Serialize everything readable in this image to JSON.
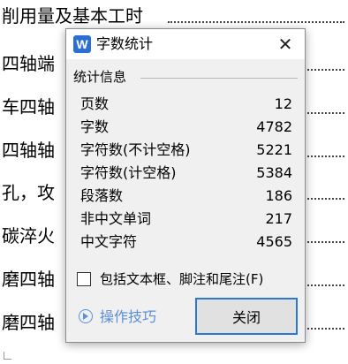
{
  "document": {
    "lines": [
      "削用量及基本工时",
      "四轴端",
      "车四轴",
      "四轴轴",
      "孔，攻",
      "碳淬火",
      "磨四轴",
      "磨四轴"
    ]
  },
  "dialog": {
    "title": "字数统计",
    "icon_letter": "W",
    "close_glyph": "✕",
    "group_label": "统计信息",
    "stats": [
      {
        "label": "页数",
        "value": "12"
      },
      {
        "label": "字数",
        "value": "4782"
      },
      {
        "label": "字符数(不计空格)",
        "value": "5221"
      },
      {
        "label": "字符数(计空格)",
        "value": "5384"
      },
      {
        "label": "段落数",
        "value": "186"
      },
      {
        "label": "非中文单词",
        "value": "217"
      },
      {
        "label": "中文字符",
        "value": "4565"
      }
    ],
    "checkbox_label": "包括文本框、脚注和尾注(F)",
    "checkbox_checked": false,
    "tips_label": "操作技巧",
    "close_button_label": "关闭"
  },
  "colors": {
    "accent": "#2a78d3",
    "link": "#5b8fd6",
    "dialog_bg": "#f0f0f0"
  },
  "icons": {
    "app": "wps-writer-icon",
    "close": "close-icon",
    "tips": "play-circle-icon"
  }
}
